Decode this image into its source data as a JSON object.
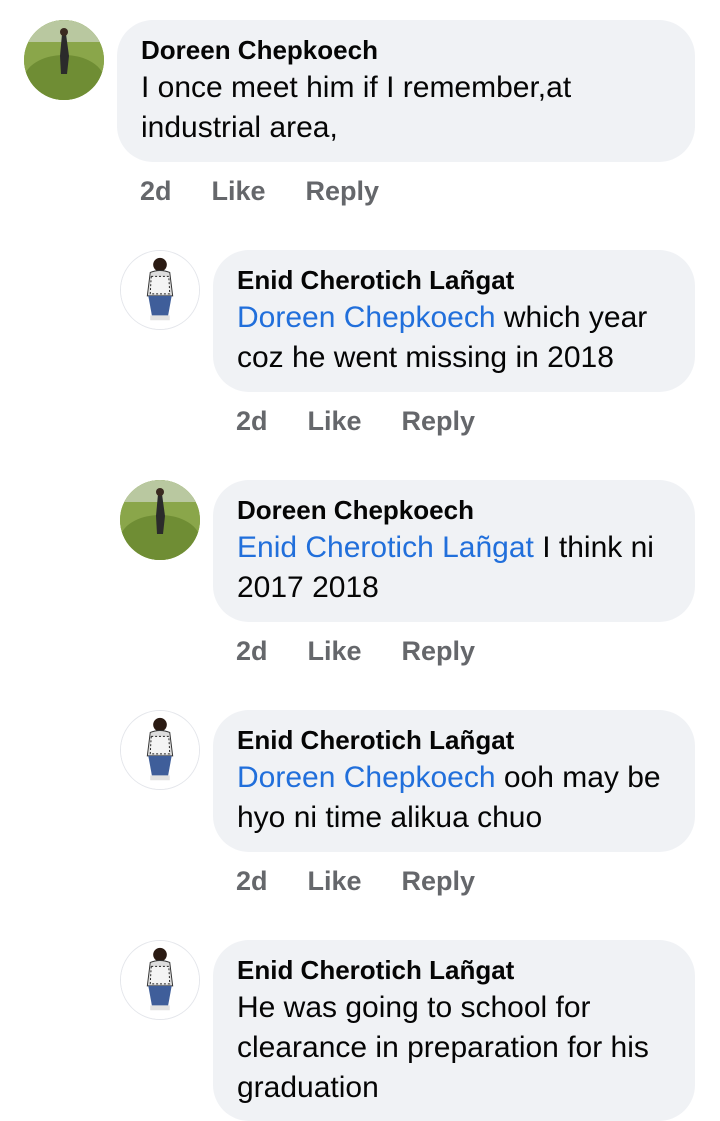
{
  "comments": [
    {
      "author": "Doreen Chepkoech",
      "mention": "",
      "text": "I once meet him if I remember,at industrial area,",
      "time": "2d",
      "like": "Like",
      "reply": "Reply"
    },
    {
      "author": "Enid Cherotich Lañgat",
      "mention": "Doreen Chepkoech",
      "text": " which year coz he went missing in 2018",
      "time": "2d",
      "like": "Like",
      "reply": "Reply"
    },
    {
      "author": "Doreen Chepkoech",
      "mention": "Enid Cherotich Lañgat",
      "text": " I think ni 2017 2018",
      "time": "2d",
      "like": "Like",
      "reply": "Reply"
    },
    {
      "author": "Enid Cherotich Lañgat",
      "mention": "Doreen Chepkoech",
      "text": " ooh may be hyo ni time alikua chuo",
      "time": "2d",
      "like": "Like",
      "reply": "Reply"
    },
    {
      "author": "Enid Cherotich Lañgat",
      "mention": "",
      "text": "He was going to school for clearance in preparation for his graduation",
      "time": "",
      "like": "",
      "reply": ""
    }
  ],
  "colors": {
    "bubble": "#f0f2f5",
    "mention": "#216fdb",
    "meta": "#65676b"
  }
}
